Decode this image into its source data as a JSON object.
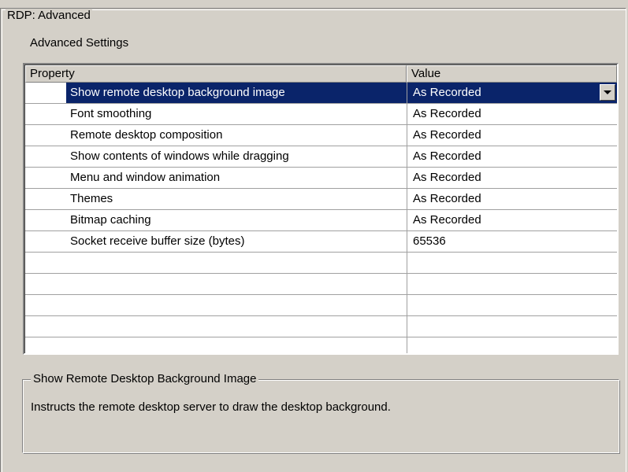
{
  "window": {
    "group_title": "RDP: Advanced",
    "section_label": "Advanced Settings"
  },
  "grid": {
    "columns": [
      "Property",
      "Value"
    ],
    "rows": [
      {
        "property": "Show remote desktop background image",
        "value": "As Recorded",
        "selected": true
      },
      {
        "property": "Font smoothing",
        "value": "As Recorded",
        "selected": false
      },
      {
        "property": "Remote desktop composition",
        "value": "As Recorded",
        "selected": false
      },
      {
        "property": "Show contents of windows while dragging",
        "value": "As Recorded",
        "selected": false
      },
      {
        "property": "Menu and window animation",
        "value": "As Recorded",
        "selected": false
      },
      {
        "property": "Themes",
        "value": "As Recorded",
        "selected": false
      },
      {
        "property": "Bitmap caching",
        "value": "As Recorded",
        "selected": false
      },
      {
        "property": "Socket receive buffer size (bytes)",
        "value": "65536",
        "selected": false
      },
      {
        "property": "",
        "value": "",
        "selected": false
      },
      {
        "property": "",
        "value": "",
        "selected": false
      },
      {
        "property": "",
        "value": "",
        "selected": false
      },
      {
        "property": "",
        "value": "",
        "selected": false
      },
      {
        "property": "",
        "value": "",
        "selected": false
      }
    ]
  },
  "description": {
    "title": "Show Remote Desktop Background Image",
    "text": "Instructs the remote desktop server to draw the desktop background."
  },
  "colors": {
    "selection": "#0a246a",
    "dialog_bg": "#d4d0c8"
  },
  "icons": {
    "dropdown": "chevron-down-icon"
  }
}
